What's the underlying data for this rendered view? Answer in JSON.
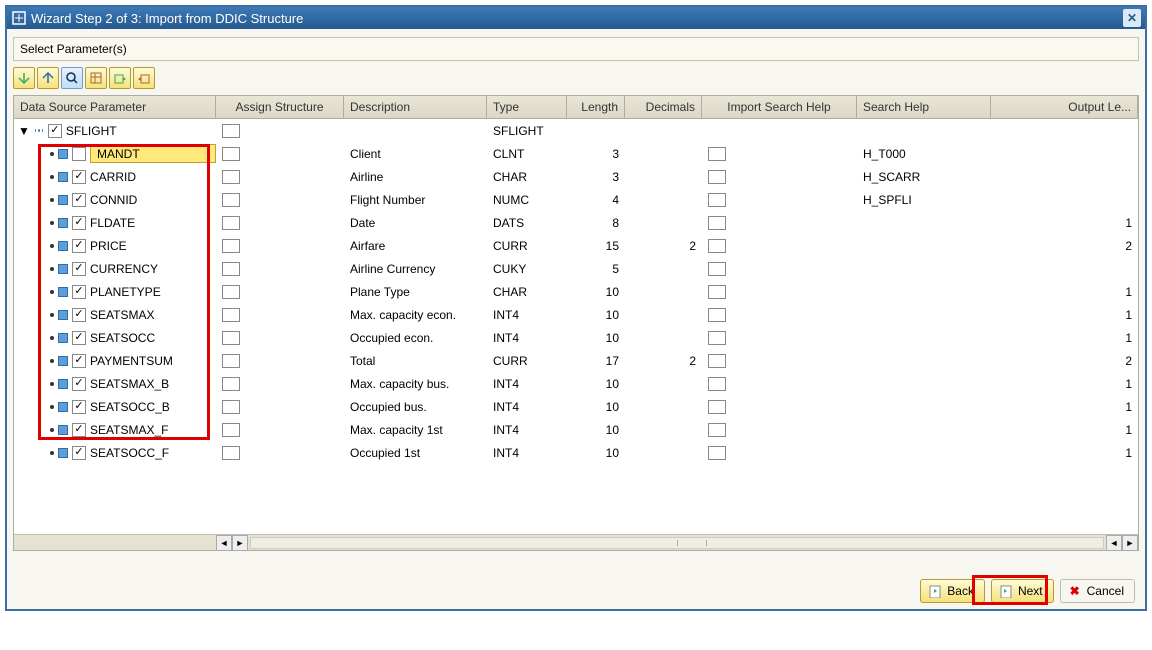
{
  "window": {
    "title": "Wizard Step 2 of 3: Import from DDIC Structure"
  },
  "section_label": "Select Parameter(s)",
  "columns": {
    "data_source": "Data Source Parameter",
    "assign_struct": "Assign Structure",
    "description": "Description",
    "type": "Type",
    "length": "Length",
    "decimals": "Decimals",
    "import_sh": "Import Search Help",
    "search_help": "Search Help",
    "output_len": "Output Le..."
  },
  "root": {
    "name": "SFLIGHT",
    "type": "SFLIGHT"
  },
  "params": [
    {
      "name": "MANDT",
      "checked": false,
      "desc": "Client",
      "type": "CLNT",
      "len": "3",
      "dec": "",
      "sh": "H_T000",
      "out": "",
      "highlight": true
    },
    {
      "name": "CARRID",
      "checked": true,
      "desc": "Airline",
      "type": "CHAR",
      "len": "3",
      "dec": "",
      "sh": "H_SCARR",
      "out": ""
    },
    {
      "name": "CONNID",
      "checked": true,
      "desc": "Flight Number",
      "type": "NUMC",
      "len": "4",
      "dec": "",
      "sh": "H_SPFLI",
      "out": ""
    },
    {
      "name": "FLDATE",
      "checked": true,
      "desc": "Date",
      "type": "DATS",
      "len": "8",
      "dec": "",
      "sh": "",
      "out": "1"
    },
    {
      "name": "PRICE",
      "checked": true,
      "desc": "Airfare",
      "type": "CURR",
      "len": "15",
      "dec": "2",
      "sh": "",
      "out": "2"
    },
    {
      "name": "CURRENCY",
      "checked": true,
      "desc": "Airline Currency",
      "type": "CUKY",
      "len": "5",
      "dec": "",
      "sh": "",
      "out": ""
    },
    {
      "name": "PLANETYPE",
      "checked": true,
      "desc": "Plane Type",
      "type": "CHAR",
      "len": "10",
      "dec": "",
      "sh": "",
      "out": "1"
    },
    {
      "name": "SEATSMAX",
      "checked": true,
      "desc": "Max. capacity econ.",
      "type": "INT4",
      "len": "10",
      "dec": "",
      "sh": "",
      "out": "1"
    },
    {
      "name": "SEATSOCC",
      "checked": true,
      "desc": "Occupied econ.",
      "type": "INT4",
      "len": "10",
      "dec": "",
      "sh": "",
      "out": "1"
    },
    {
      "name": "PAYMENTSUM",
      "checked": true,
      "desc": "Total",
      "type": "CURR",
      "len": "17",
      "dec": "2",
      "sh": "",
      "out": "2"
    },
    {
      "name": "SEATSMAX_B",
      "checked": true,
      "desc": "Max. capacity bus.",
      "type": "INT4",
      "len": "10",
      "dec": "",
      "sh": "",
      "out": "1"
    },
    {
      "name": "SEATSOCC_B",
      "checked": true,
      "desc": "Occupied bus.",
      "type": "INT4",
      "len": "10",
      "dec": "",
      "sh": "",
      "out": "1"
    },
    {
      "name": "SEATSMAX_F",
      "checked": true,
      "desc": "Max. capacity 1st",
      "type": "INT4",
      "len": "10",
      "dec": "",
      "sh": "",
      "out": "1"
    },
    {
      "name": "SEATSOCC_F",
      "checked": true,
      "desc": "Occupied 1st",
      "type": "INT4",
      "len": "10",
      "dec": "",
      "sh": "",
      "out": "1"
    }
  ],
  "buttons": {
    "back": "Back",
    "next": "Next",
    "cancel": "Cancel"
  }
}
